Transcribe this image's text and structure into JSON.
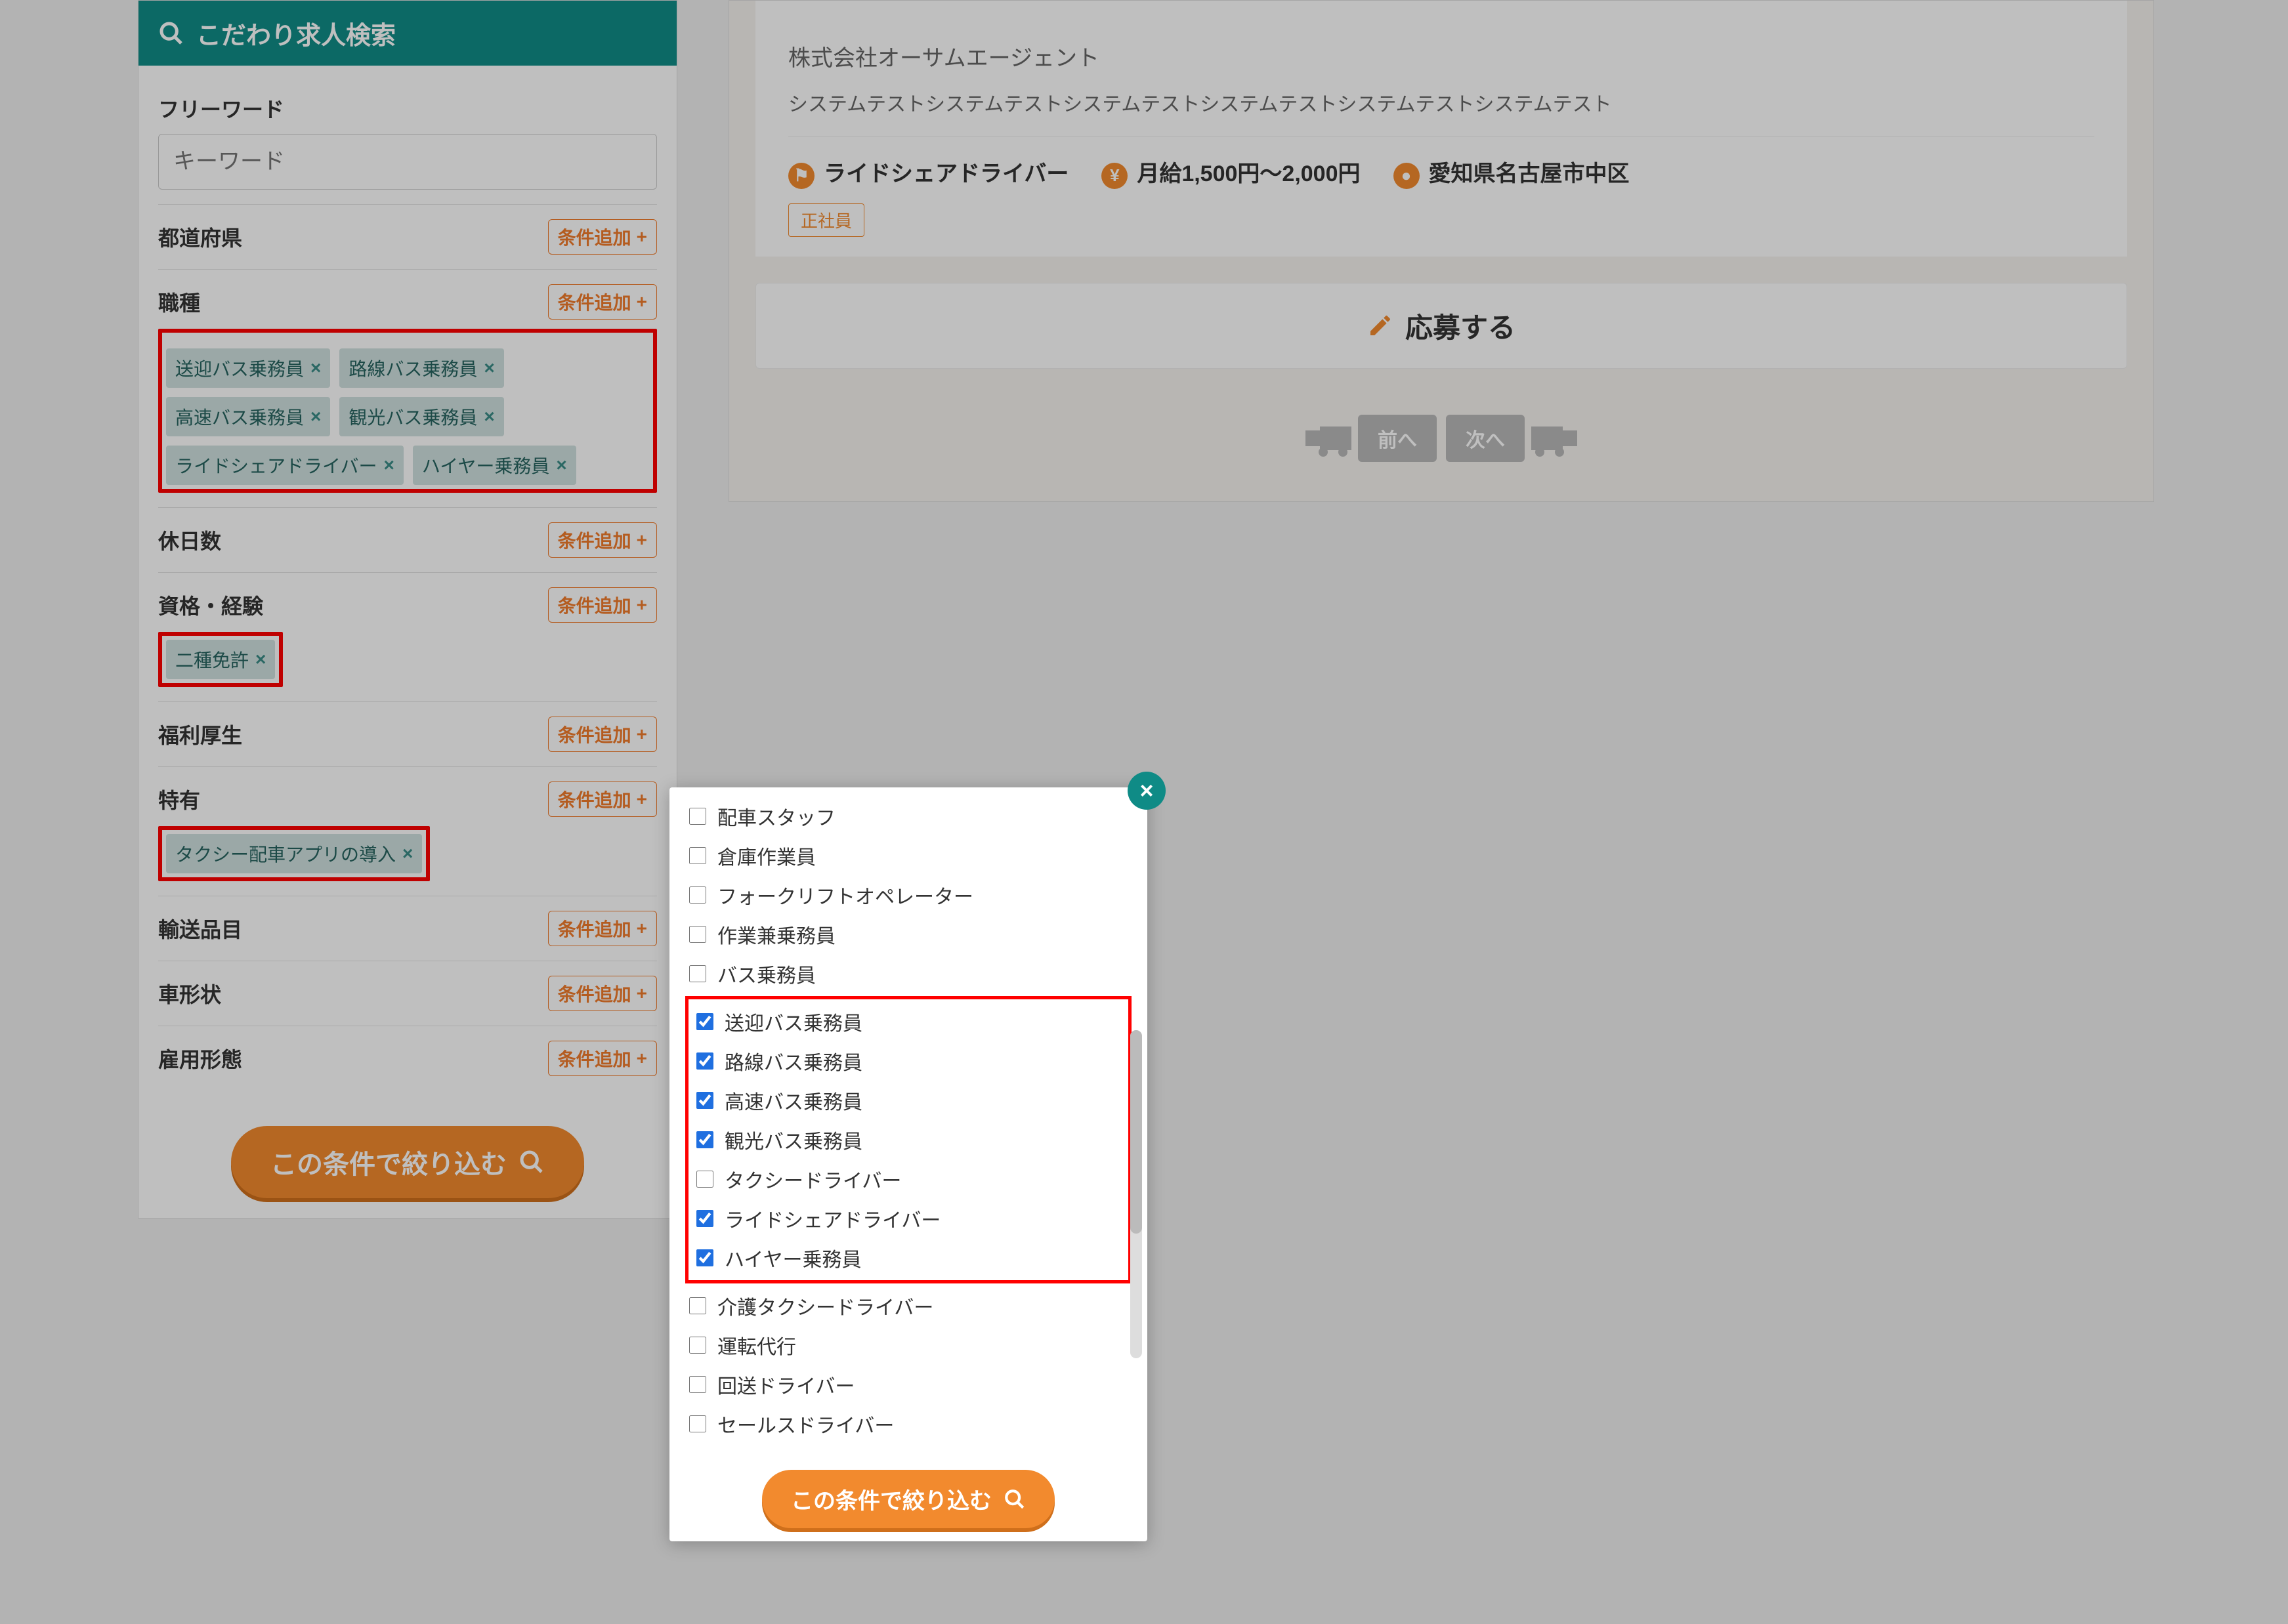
{
  "sidebar": {
    "title": "こだわり求人検索",
    "freeword_label": "フリーワード",
    "freeword_placeholder": "キーワード",
    "add_btn": "条件追加",
    "sections": {
      "pref": "都道府県",
      "occupation": "職種",
      "days_off": "休日数",
      "license": "資格・経験",
      "welfare": "福利厚生",
      "special": "特有",
      "cargo": "輸送品目",
      "shape": "車形状",
      "employment": "雇用形態"
    },
    "occupation_chips": [
      "送迎バス乗務員",
      "路線バス乗務員",
      "高速バス乗務員",
      "観光バス乗務員",
      "ライドシェアドライバー",
      "ハイヤー乗務員"
    ],
    "license_chips": [
      "二種免許"
    ],
    "special_chips": [
      "タクシー配車アプリの導入"
    ],
    "submit": "この条件で絞り込む"
  },
  "job": {
    "company": "株式会社オーサムエージェント",
    "description": "システムテストシステムテストシステムテストシステムテストシステムテストシステムテスト",
    "role": "ライドシェアドライバー",
    "salary": "月給1,500円～2,000円",
    "location": "愛知県名古屋市中区",
    "employment_badge": "正社員",
    "apply": "応募する",
    "prev": "前へ",
    "next": "次へ"
  },
  "popup": {
    "submit": "この条件で絞り込む",
    "options": [
      {
        "label": "配車スタッフ",
        "checked": false
      },
      {
        "label": "倉庫作業員",
        "checked": false
      },
      {
        "label": "フォークリフトオペレーター",
        "checked": false
      },
      {
        "label": "作業兼乗務員",
        "checked": false
      },
      {
        "label": "バス乗務員",
        "checked": false
      },
      {
        "label": "送迎バス乗務員",
        "checked": true,
        "hl": true
      },
      {
        "label": "路線バス乗務員",
        "checked": true,
        "hl": true
      },
      {
        "label": "高速バス乗務員",
        "checked": true,
        "hl": true
      },
      {
        "label": "観光バス乗務員",
        "checked": true,
        "hl": true
      },
      {
        "label": "タクシードライバー",
        "checked": false,
        "hl": true
      },
      {
        "label": "ライドシェアドライバー",
        "checked": true,
        "hl": true
      },
      {
        "label": "ハイヤー乗務員",
        "checked": true,
        "hl": true
      },
      {
        "label": "介護タクシードライバー",
        "checked": false
      },
      {
        "label": "運転代行",
        "checked": false
      },
      {
        "label": "回送ドライバー",
        "checked": false
      },
      {
        "label": "セールスドライバー",
        "checked": false
      }
    ]
  }
}
